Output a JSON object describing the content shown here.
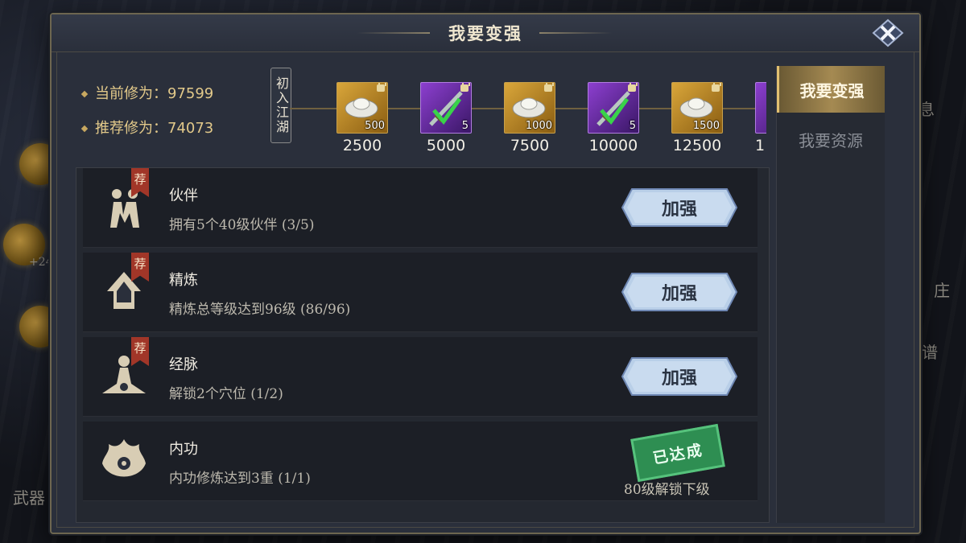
{
  "dialog": {
    "title": "我要变强"
  },
  "stats": {
    "current_label": "当前修为：",
    "current_value": "97599",
    "recommended_label": "推荐修为：",
    "recommended_value": "74073"
  },
  "stage_tag": "初入江湖",
  "rewards": [
    {
      "points": "2500",
      "count": "500",
      "type": "gold",
      "locked": true
    },
    {
      "points": "5000",
      "count": "5",
      "type": "purple",
      "locked": true
    },
    {
      "points": "7500",
      "count": "1000",
      "type": "gold",
      "locked": true
    },
    {
      "points": "10000",
      "count": "5",
      "type": "purple",
      "locked": true
    },
    {
      "points": "12500",
      "count": "1500",
      "type": "gold",
      "locked": true
    },
    {
      "points": "1",
      "count": "",
      "type": "purple",
      "locked": false
    }
  ],
  "tabs": [
    {
      "label": "我要变强",
      "active": true
    },
    {
      "label": "我要资源",
      "active": false
    }
  ],
  "tasks": [
    {
      "name": "伙伴",
      "desc": "拥有5个40级伙伴 (3/5)",
      "recommended": "荐",
      "action": "加强",
      "icon": "partner-icon"
    },
    {
      "name": "精炼",
      "desc": "精炼总等级达到96级 (86/96)",
      "recommended": "荐",
      "action": "加强",
      "icon": "refine-icon"
    },
    {
      "name": "经脉",
      "desc": "解锁2个穴位 (1/2)",
      "recommended": "荐",
      "action": "加强",
      "icon": "meridian-icon"
    },
    {
      "name": "内功",
      "desc": "内功修炼达到3重 (1/1)",
      "stamp": "已达成",
      "note": "80级解锁下级",
      "icon": "inner-power-icon"
    }
  ],
  "background": {
    "left_text": "武器",
    "right_texts": [
      "息",
      "庄",
      "谱"
    ],
    "bonus_text": "+24"
  },
  "colors": {
    "accent_gold": "#e2c98a",
    "panel": "#2a2f3b",
    "button": "#a9c4e6"
  }
}
